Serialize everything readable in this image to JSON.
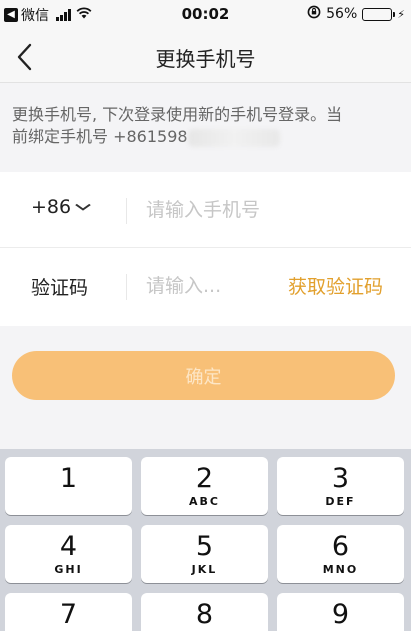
{
  "status_bar": {
    "back_app": "微信",
    "time": "00:02",
    "battery": "56%",
    "battery_level": 0.56
  },
  "nav": {
    "title": "更换手机号"
  },
  "notice": {
    "line1": "更换手机号, 下次登录使用新的手机号登录。当",
    "line2_prefix": "前绑定手机号 +861598"
  },
  "form": {
    "country_code": "+86",
    "phone_placeholder": "请输入手机号",
    "code_label": "验证码",
    "code_placeholder": "请输入...",
    "get_code": "获取验证码"
  },
  "confirm": {
    "label": "确定"
  },
  "keypad": [
    {
      "num": "1",
      "letters": ""
    },
    {
      "num": "2",
      "letters": "ABC"
    },
    {
      "num": "3",
      "letters": "DEF"
    },
    {
      "num": "4",
      "letters": "GHI"
    },
    {
      "num": "5",
      "letters": "JKL"
    },
    {
      "num": "6",
      "letters": "MNO"
    },
    {
      "num": "7",
      "letters": ""
    },
    {
      "num": "8",
      "letters": ""
    },
    {
      "num": "9",
      "letters": ""
    }
  ],
  "colors": {
    "accent": "#e2a02d",
    "button": "#f8c077",
    "battery": "#4cd964"
  }
}
